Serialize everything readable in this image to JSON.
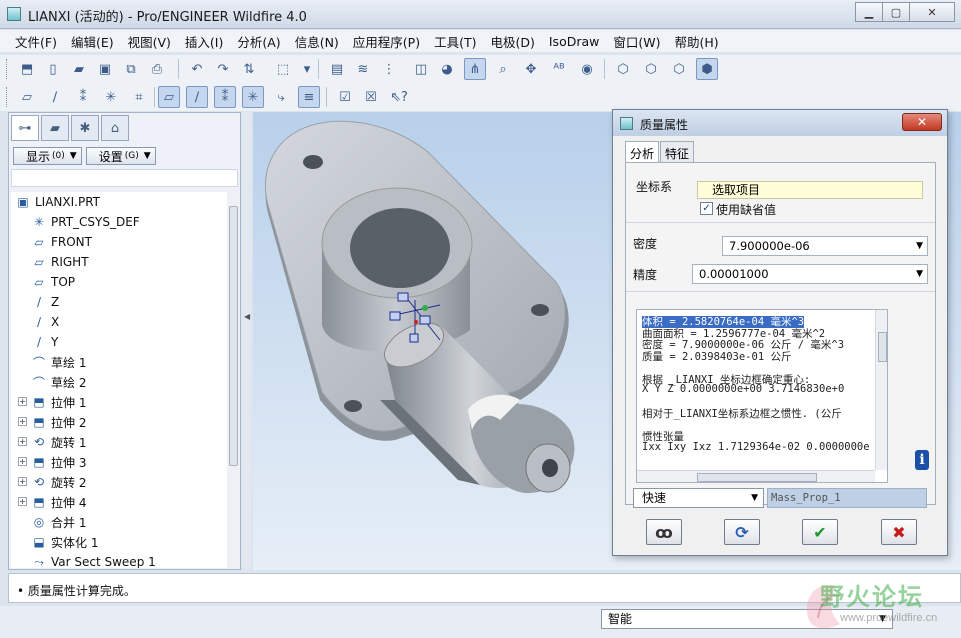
{
  "window": {
    "title": "LIANXI (活动的) - Pro/ENGINEER Wildfire 4.0",
    "controls": [
      "minimize",
      "maximize",
      "close"
    ]
  },
  "menu": [
    "文件(F)",
    "编辑(E)",
    "视图(V)",
    "插入(I)",
    "分析(A)",
    "信息(N)",
    "应用程序(P)",
    "工具(T)",
    "电极(D)",
    "IsoDraw",
    "窗口(W)",
    "帮助(H)"
  ],
  "nav": {
    "show_label": "显示",
    "show_count": "(0)",
    "settings_label": "设置",
    "settings_count": "(G)"
  },
  "tree": [
    {
      "label": "LIANXI.PRT",
      "icon": "part-icon"
    },
    {
      "label": "PRT_CSYS_DEF",
      "icon": "csys-icon"
    },
    {
      "label": "FRONT",
      "icon": "datum-plane-icon"
    },
    {
      "label": "RIGHT",
      "icon": "datum-plane-icon"
    },
    {
      "label": "TOP",
      "icon": "datum-plane-icon"
    },
    {
      "label": "Z",
      "icon": "datum-axis-icon"
    },
    {
      "label": "X",
      "icon": "datum-axis-icon"
    },
    {
      "label": "Y",
      "icon": "datum-axis-icon"
    },
    {
      "label": "草绘 1",
      "icon": "sketch-icon"
    },
    {
      "label": "草绘 2",
      "icon": "sketch-icon"
    },
    {
      "label": "拉伸 1",
      "icon": "extrude-icon"
    },
    {
      "label": "拉伸 2",
      "icon": "extrude-icon"
    },
    {
      "label": "旋转 1",
      "icon": "revolve-icon"
    },
    {
      "label": "拉伸 3",
      "icon": "extrude-icon"
    },
    {
      "label": "旋转 2",
      "icon": "revolve-icon"
    },
    {
      "label": "拉伸 4",
      "icon": "extrude-icon"
    },
    {
      "label": "合并 1",
      "icon": "merge-icon"
    },
    {
      "label": "实体化 1",
      "icon": "solidify-icon"
    },
    {
      "label": "Var Sect Sweep 1",
      "icon": "sweep-icon"
    }
  ],
  "dialog": {
    "title": "质量属性",
    "tabs": [
      "分析",
      "特征"
    ],
    "csys_label": "坐标系",
    "csys_value": "选取项目",
    "use_default_label": "使用缺省值",
    "use_default_checked": true,
    "density_label": "密度",
    "density_value": "7.900000e-06",
    "precision_label": "精度",
    "precision_value": "0.00001000",
    "results": [
      "体积 =  2.5820764e-04  毫米^3",
      "曲面面积 =  1.2596777e-04  毫米^2",
      "密度 =  7.9000000e-06 公斤 / 毫米^3",
      "质量 =  2.0398403e-01 公斤",
      "",
      "根据 _LIANXI 坐标边框确定重心:",
      "X   Y   Z  0.0000000e+00  3.7146830e+0",
      "",
      "相对于_LIANXI坐标系边框之惯性. (公斤",
      "",
      "惯性张量",
      "Ixx Ixy Ixz  1.7129364e-02  0.0000000e"
    ],
    "mode_value": "快速",
    "name_value": "Mass_Prop_1",
    "buttons": [
      "preview",
      "repeat",
      "ok",
      "cancel"
    ]
  },
  "status": {
    "message": "质量属性计算完成。",
    "filter_value": "智能"
  },
  "watermark": {
    "text": "野火论坛",
    "url": "www.proewildfire.cn"
  }
}
